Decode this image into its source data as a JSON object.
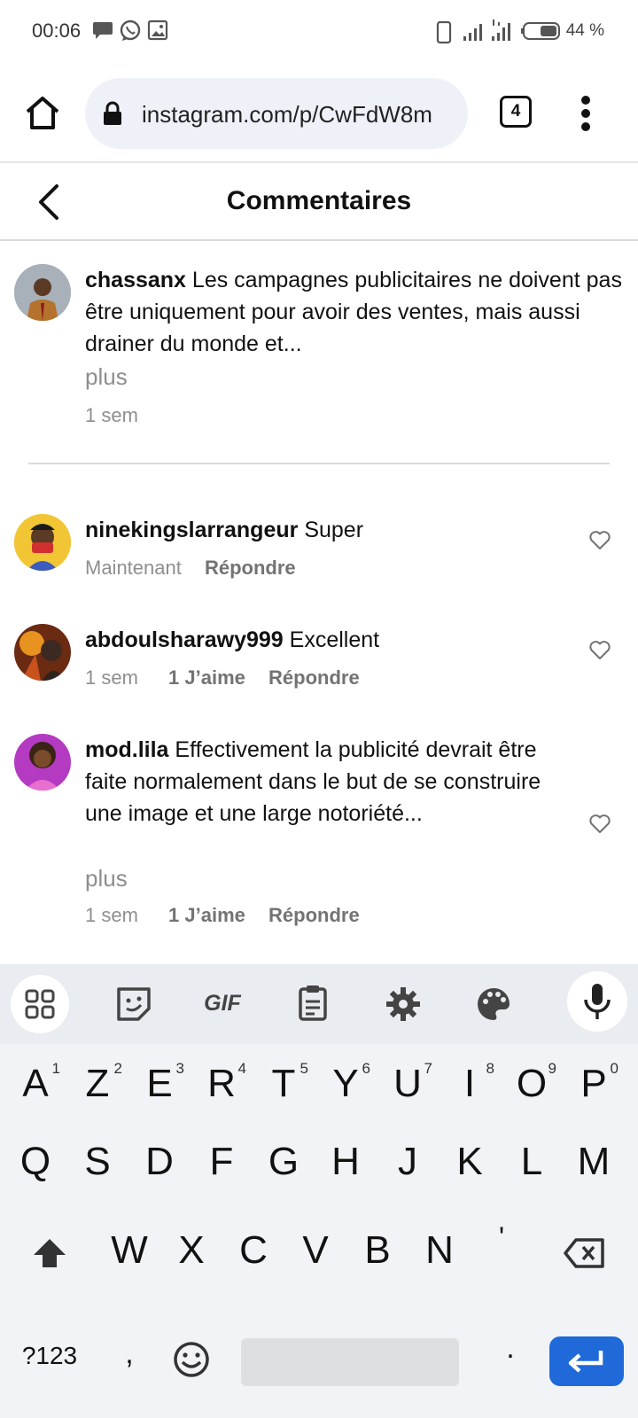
{
  "status_bar": {
    "time": "00:06",
    "battery": "44 %"
  },
  "browser": {
    "url": "instagram.com/p/CwFdW8m",
    "tab_count": "4"
  },
  "header": {
    "title": "Commentaires"
  },
  "caption": {
    "username": "chassanx",
    "text": "Les campagnes publicitaires ne doivent pas être uniquement pour avoir des ventes, mais aussi drainer du monde et...",
    "more": "plus",
    "time": "1 sem"
  },
  "comments": [
    {
      "username": "ninekingslarrangeur",
      "text": "Super",
      "time": "Maintenant",
      "likes": "",
      "reply": "Répondre"
    },
    {
      "username": "abdoulsharawy999",
      "text": "Excellent",
      "time": "1 sem",
      "likes": "1 J’aime",
      "reply": "Répondre"
    },
    {
      "username": "mod.lila",
      "text": "Effectivement la publicité devrait être faite normalement dans le but de se construire une image et une large notoriété...",
      "more": "plus",
      "time": "1 sem",
      "likes": "1 J’aime",
      "reply": "Répondre"
    }
  ],
  "keyboard": {
    "toolbar_gif": "GIF",
    "row1": [
      "A",
      "Z",
      "E",
      "R",
      "T",
      "Y",
      "U",
      "I",
      "O",
      "P"
    ],
    "row1_hints": [
      "1",
      "2",
      "3",
      "4",
      "5",
      "6",
      "7",
      "8",
      "9",
      "0"
    ],
    "row2": [
      "Q",
      "S",
      "D",
      "F",
      "G",
      "H",
      "J",
      "K",
      "L",
      "M"
    ],
    "row3": [
      "W",
      "X",
      "C",
      "V",
      "B",
      "N",
      "'"
    ],
    "symbols": "?123",
    "comma": ",",
    "period": "."
  },
  "colors": {
    "accent": "#1f6ad8",
    "url_bg": "#eef1f8",
    "muted_text": "#8e8e8e"
  }
}
